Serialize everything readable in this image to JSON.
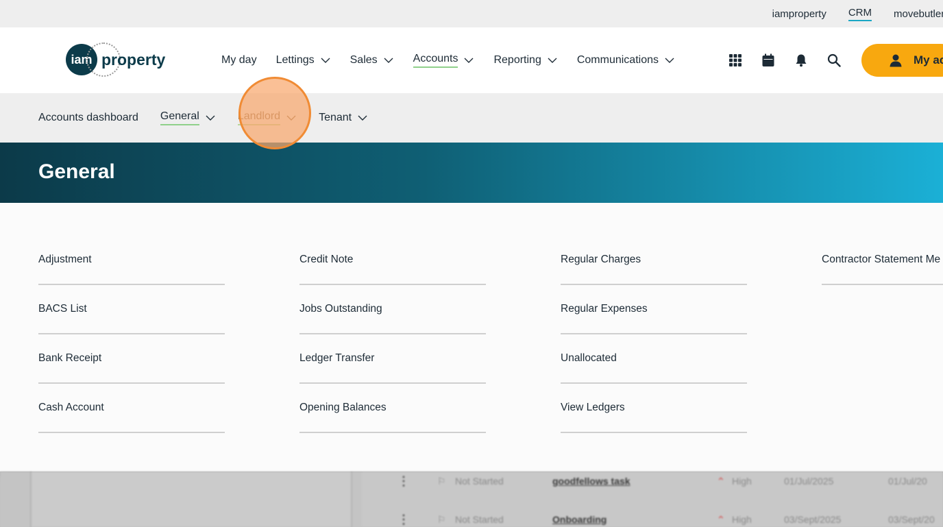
{
  "topbar": {
    "links": [
      "iamproperty",
      "CRM",
      "movebutler"
    ]
  },
  "header": {
    "logo_badge": "iam",
    "logo_text": "property",
    "nav": [
      {
        "label": "My day",
        "dropdown": false
      },
      {
        "label": "Lettings",
        "dropdown": true
      },
      {
        "label": "Sales",
        "dropdown": true
      },
      {
        "label": "Accounts",
        "dropdown": true,
        "active": true
      },
      {
        "label": "Reporting",
        "dropdown": true
      },
      {
        "label": "Communications",
        "dropdown": true
      }
    ],
    "icons": [
      "apps-grid-icon",
      "calendar-icon",
      "bell-icon",
      "search-icon"
    ],
    "account_label": "My ac"
  },
  "subnav": {
    "items": [
      "Accounts dashboard",
      "General",
      "Landlord",
      "Tenant"
    ]
  },
  "banner": {
    "title": "General"
  },
  "menu": {
    "columns": [
      [
        "Adjustment",
        "BACS List",
        "Bank Receipt",
        "Cash Account"
      ],
      [
        "Credit Note",
        "Jobs Outstanding",
        "Ledger Transfer",
        "Opening Balances"
      ],
      [
        "Regular Charges",
        "Regular Expenses",
        "Unallocated",
        "View Ledgers"
      ],
      [
        "Contractor Statement Me"
      ]
    ]
  },
  "tasks": [
    {
      "status": "Not Started",
      "name": "goodfellows task",
      "priority": "High",
      "date1": "01/Jul/2025",
      "date2": "01/Jul/20"
    },
    {
      "status": "Not Started",
      "name": "Onboarding",
      "priority": "High",
      "date1": "03/Sept/2025",
      "date2": "03/Sept/20"
    }
  ],
  "colors": {
    "accent": "#f8a80f",
    "brand_dark": "#0c3b4a",
    "banner_end": "#1bb0d6",
    "active_underline": "#8fd08a"
  }
}
